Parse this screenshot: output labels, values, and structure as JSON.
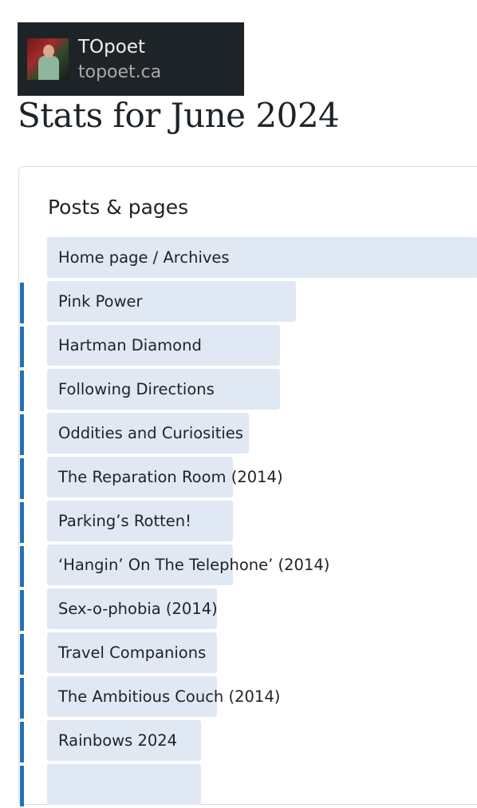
{
  "site": {
    "name": "TOpoet",
    "url": "topoet.ca"
  },
  "page_title": "Stats for June 2024",
  "posts_pages": {
    "title": "Posts & pages",
    "rows": [
      {
        "label": "Home page / Archives",
        "share": 1.0,
        "marked": false
      },
      {
        "label": "Pink Power",
        "share": 0.578,
        "marked": true
      },
      {
        "label": "Hartman Diamond",
        "share": 0.541,
        "marked": true
      },
      {
        "label": "Following Directions",
        "share": 0.541,
        "marked": true
      },
      {
        "label": "Oddities and Curiosities",
        "share": 0.468,
        "marked": true
      },
      {
        "label": "The Reparation Room (2014)",
        "share": 0.431,
        "marked": true
      },
      {
        "label": "Parking’s Rotten!",
        "share": 0.431,
        "marked": true
      },
      {
        "label": "‘Hangin’ On The Telephone’ (2014)",
        "share": 0.431,
        "marked": true
      },
      {
        "label": "Sex-o-phobia (2014)",
        "share": 0.394,
        "marked": true
      },
      {
        "label": "Travel Companions",
        "share": 0.394,
        "marked": true
      },
      {
        "label": "The Ambitious Couch (2014)",
        "share": 0.394,
        "marked": true
      },
      {
        "label": "Rainbows 2024",
        "share": 0.358,
        "marked": true
      },
      {
        "label": "",
        "share": 0.358,
        "marked": true
      }
    ]
  },
  "colors": {
    "bar": "#dfe8f3",
    "marker": "#2271b1",
    "header_bg": "#1d2327"
  }
}
